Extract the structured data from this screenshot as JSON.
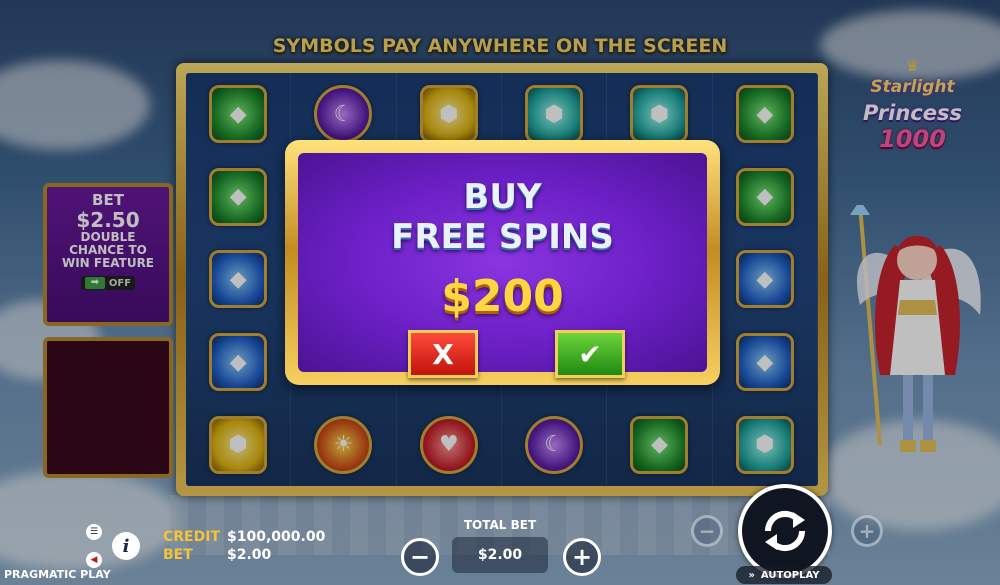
{
  "header": {
    "text": "SYMBOLS PAY ANYWHERE ON THE SCREEN"
  },
  "logo": {
    "line1": "Starlight",
    "line2": "Princess",
    "line3": "1000"
  },
  "bet_panel": {
    "title": "BET",
    "amount": "$2.50",
    "desc_line1": "DOUBLE",
    "desc_line2": "CHANCE TO",
    "desc_line3": "WIN FEATURE",
    "toggle_state": "OFF"
  },
  "grid": {
    "rows": [
      [
        "green",
        "purple",
        "yellow",
        "teal",
        "teal",
        "green"
      ],
      [
        "green",
        "",
        "",
        "",
        "",
        "green"
      ],
      [
        "blue",
        "",
        "",
        "",
        "",
        "blue"
      ],
      [
        "blue",
        "",
        "",
        "",
        "",
        "blue"
      ],
      [
        "yellow",
        "sun",
        "red",
        "purple",
        "green",
        "teal"
      ]
    ]
  },
  "modal": {
    "title_line1": "BUY",
    "title_line2": "FREE SPINS",
    "price": "$200",
    "cancel_symbol": "X",
    "confirm_symbol": "✔"
  },
  "footer": {
    "credit_label": "CREDIT",
    "credit_value": "$100,000.00",
    "bet_label": "BET",
    "bet_value": "$2.00",
    "total_bet_label": "TOTAL BET",
    "total_bet_value": "$2.00",
    "minus_symbol": "−",
    "plus_symbol": "+",
    "autoplay_label": "AUTOPLAY",
    "provider": "PRAGMATIC PLAY",
    "info_symbol": "i"
  }
}
